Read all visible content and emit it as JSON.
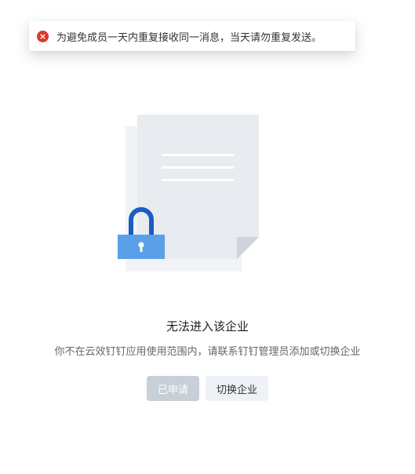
{
  "toast": {
    "type": "error",
    "icon": "error-circle-icon",
    "message": "为避免成员一天内重复接收同一消息，当天请勿重复发送。"
  },
  "illustration": {
    "icon": "locked-document-icon",
    "colors": {
      "page": "#e8ebef",
      "page_back": "#f1f3f6",
      "lock_shackle": "#1a5cc4",
      "lock_body": "#5aa0e8"
    }
  },
  "main": {
    "title": "无法进入该企业",
    "description": "你不在云效钉钉应用使用范围内，请联系钉钉管理员添加或切换企业"
  },
  "actions": {
    "applied_label": "已申请",
    "switch_label": "切换企业"
  }
}
